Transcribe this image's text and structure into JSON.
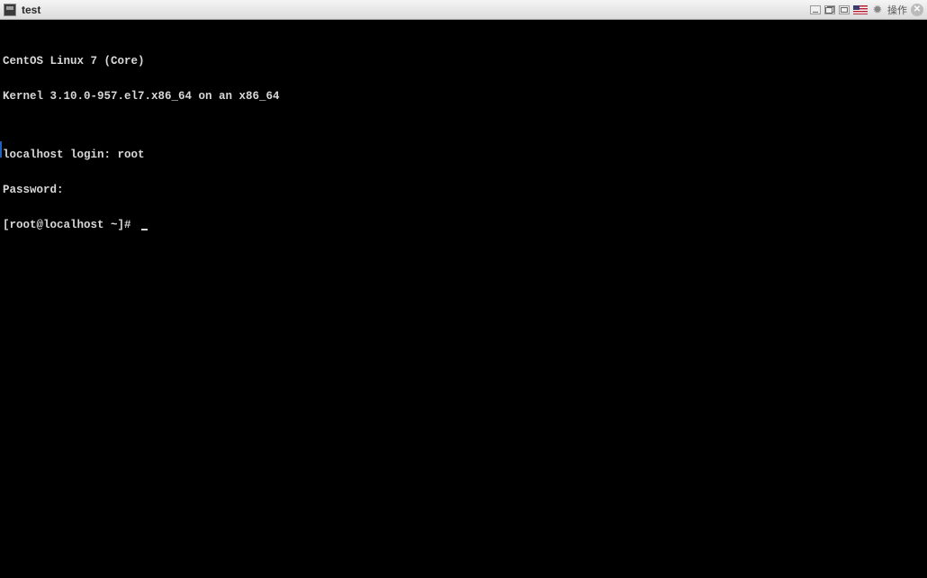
{
  "window": {
    "title": "test",
    "actions_label": "操作"
  },
  "terminal": {
    "line1": "CentOS Linux 7 (Core)",
    "line2": "Kernel 3.10.0-957.el7.x86_64 on an x86_64",
    "line3": "",
    "login_prompt": "localhost login: ",
    "login_value": "root",
    "password_prompt": "Password:",
    "shell_prompt": "[root@localhost ~]# "
  }
}
